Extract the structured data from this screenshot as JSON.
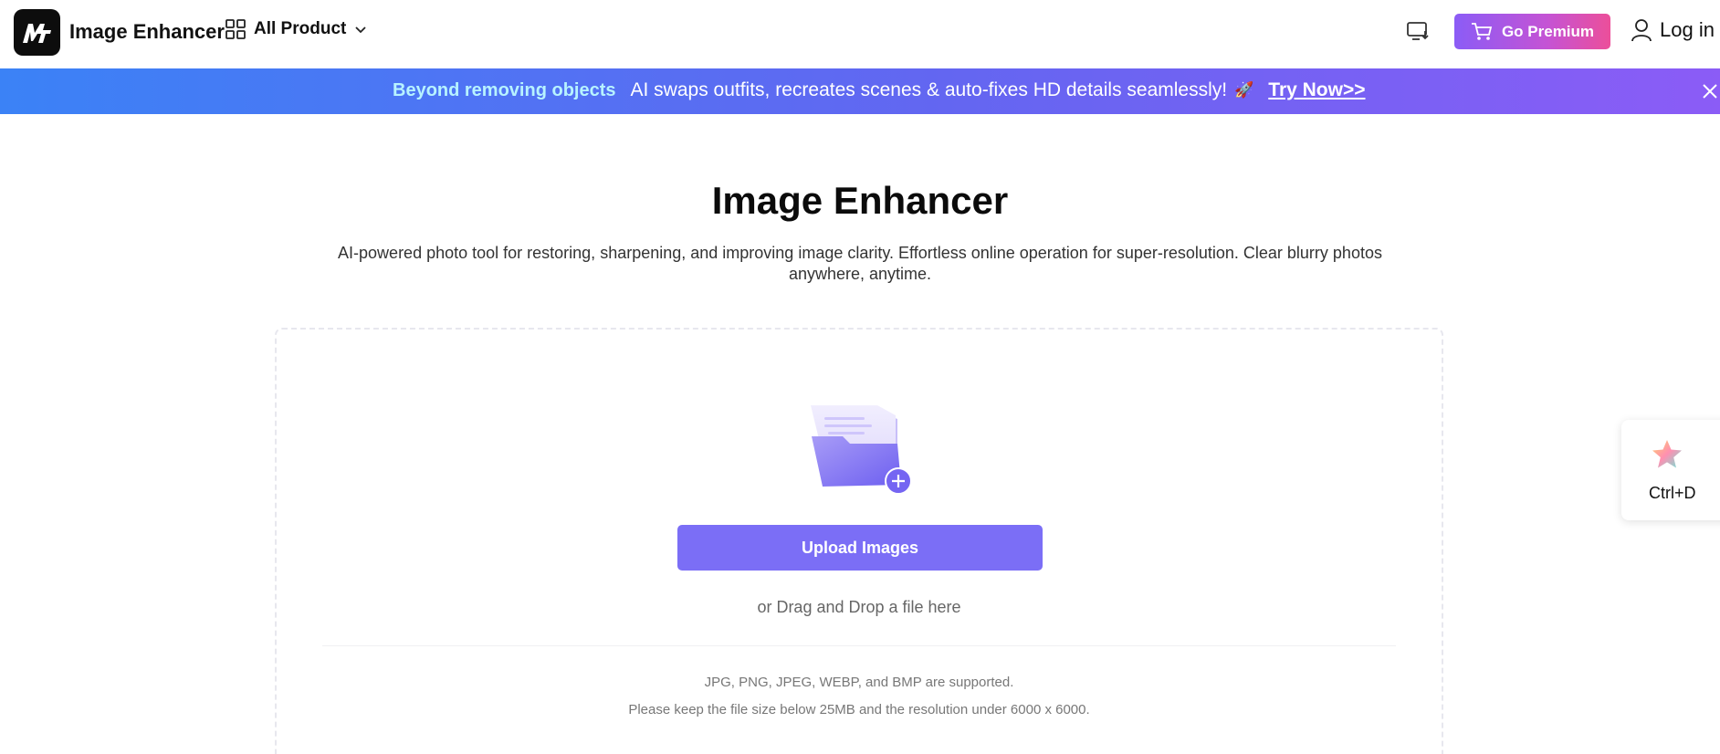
{
  "header": {
    "app_title": "Image Enhancer",
    "all_product_label": "All Product",
    "premium_label": "Go Premium",
    "login_label": "Log in",
    "logo_text": "MT"
  },
  "banner": {
    "highlight": "Beyond removing objects",
    "message": "AI swaps outfits, recreates scenes & auto-fixes HD details seamlessly!",
    "rocket": "🚀",
    "cta": "Try Now>>"
  },
  "main": {
    "title": "Image Enhancer",
    "subtitle": "AI-powered photo tool for restoring, sharpening, and improving image clarity. Effortless online operation for super-resolution. Clear blurry photos anywhere, anytime.",
    "upload_label": "Upload Images",
    "drag_text": "or Drag and Drop a file here",
    "supported_formats": "JPG, PNG, JPEG, WEBP, and BMP are supported.",
    "limits": "Please keep the file size below 25MB and the resolution under 6000 x 6000."
  },
  "bookmark": {
    "shortcut": "Ctrl+D"
  },
  "colors": {
    "accent": "#7b6ef6",
    "banner_start": "#3b82f6",
    "banner_end": "#8b5cf6",
    "premium_start": "#8b5cf6",
    "premium_end": "#ec4f9a"
  },
  "icons": {
    "logo": "mt-logo",
    "all_product": "grid-icon",
    "chevron": "chevron-down-icon",
    "monitor": "monitor-download-icon",
    "cart": "cart-icon",
    "user": "user-icon",
    "close": "close-icon",
    "folder": "folder-upload-icon",
    "star": "star-icon"
  }
}
